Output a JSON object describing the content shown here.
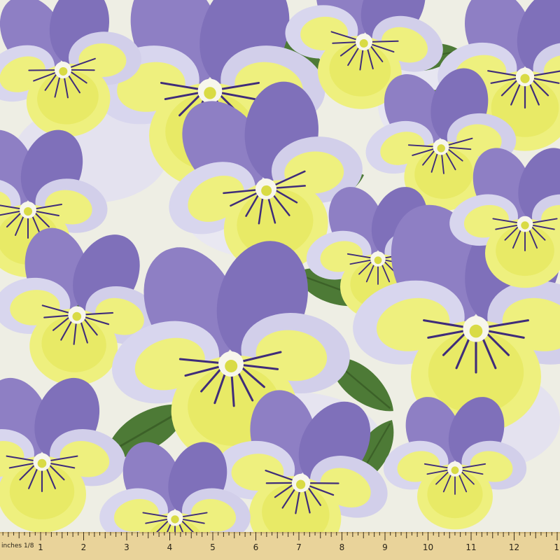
{
  "image": {
    "subject": "pansy-floral-fabric",
    "colors": {
      "background": "#eeeee4",
      "petal_purple": "#8e7fc4",
      "petal_dark_purple": "#5b4596",
      "petal_lavender": "#c9c6e6",
      "petal_white": "#ecebf3",
      "petal_yellow": "#eef07e",
      "petal_deep_yellow": "#e2e35a",
      "leaf_green": "#4d7a36",
      "leaf_dark": "#3c6128",
      "vein": "#3f2c7a",
      "ruler_wood": "#e9d39a"
    }
  },
  "ruler": {
    "unit_label": "inches 1/8",
    "numbers": [
      "1",
      "2",
      "3",
      "4",
      "5",
      "6",
      "7",
      "8",
      "9",
      "10",
      "11",
      "12",
      "1"
    ]
  }
}
